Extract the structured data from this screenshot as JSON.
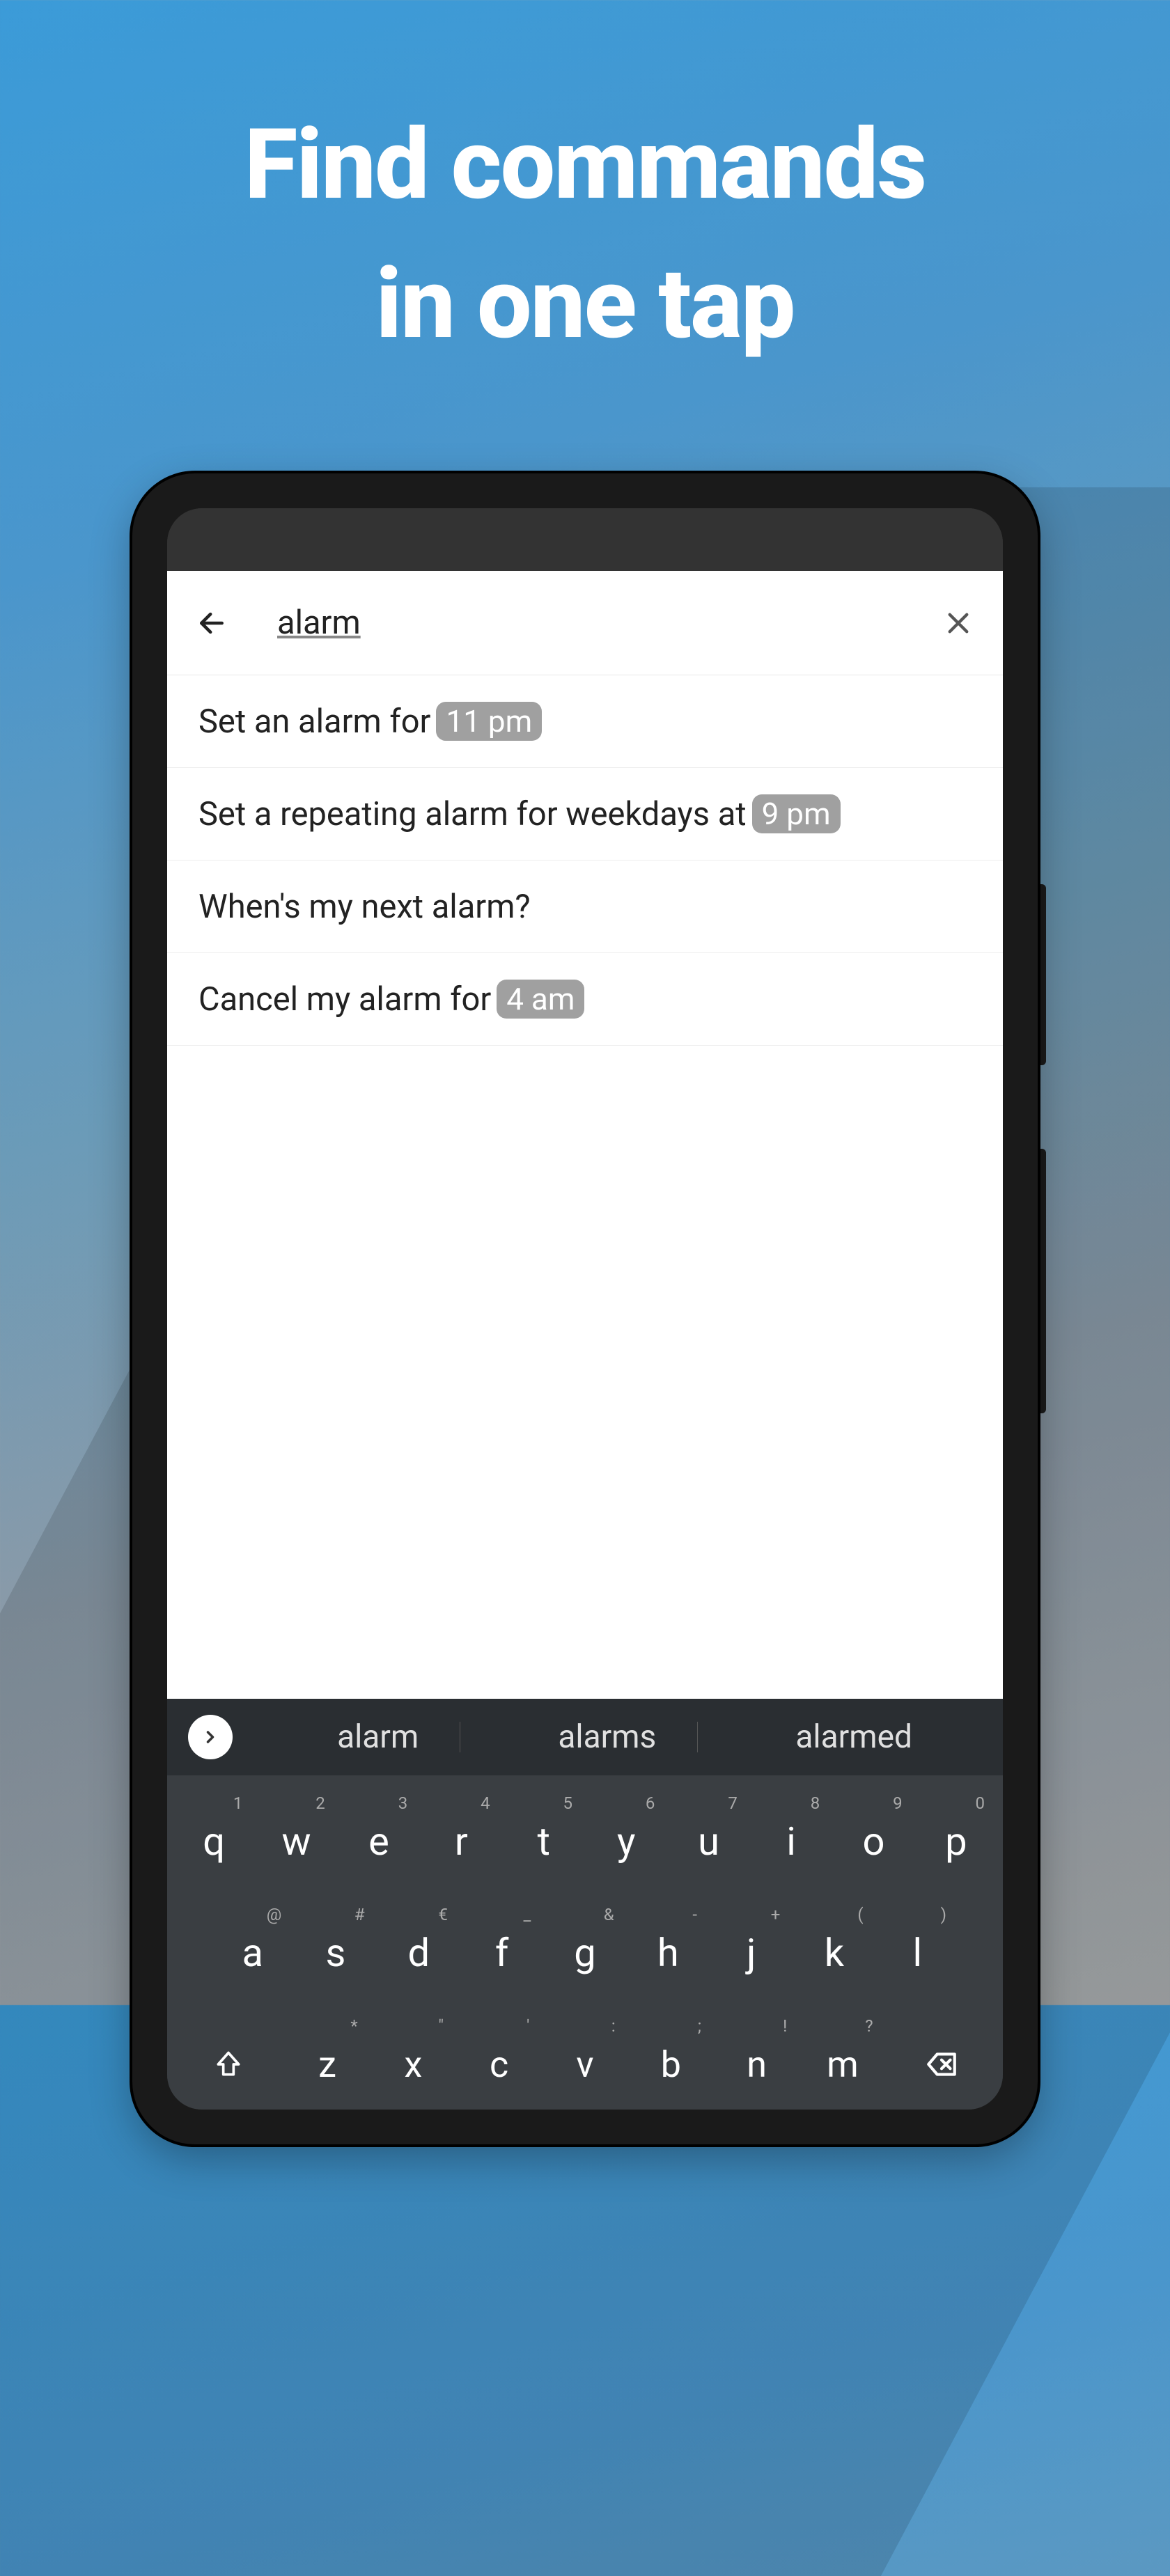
{
  "hero": {
    "line1": "Find commands",
    "line2": "in one tap"
  },
  "search": {
    "query": "alarm"
  },
  "results": [
    {
      "text": "Set an alarm for ",
      "param": "11 pm"
    },
    {
      "text": "Set a repeating alarm for weekdays at ",
      "param": "9 pm"
    },
    {
      "text": "When's my next alarm?",
      "param": null
    },
    {
      "text": "Cancel my alarm for ",
      "param": "4 am"
    }
  ],
  "keyboard": {
    "suggestions": [
      "alarm",
      "alarms",
      "alarmed"
    ],
    "row1": [
      {
        "k": "q",
        "s": "1"
      },
      {
        "k": "w",
        "s": "2"
      },
      {
        "k": "e",
        "s": "3"
      },
      {
        "k": "r",
        "s": "4"
      },
      {
        "k": "t",
        "s": "5"
      },
      {
        "k": "y",
        "s": "6"
      },
      {
        "k": "u",
        "s": "7"
      },
      {
        "k": "i",
        "s": "8"
      },
      {
        "k": "o",
        "s": "9"
      },
      {
        "k": "p",
        "s": "0"
      }
    ],
    "row2": [
      {
        "k": "a",
        "s": "@"
      },
      {
        "k": "s",
        "s": "#"
      },
      {
        "k": "d",
        "s": "€"
      },
      {
        "k": "f",
        "s": "_"
      },
      {
        "k": "g",
        "s": "&"
      },
      {
        "k": "h",
        "s": "-"
      },
      {
        "k": "j",
        "s": "+"
      },
      {
        "k": "k",
        "s": "("
      },
      {
        "k": "l",
        "s": ")"
      }
    ],
    "row3": [
      {
        "k": "z",
        "s": "*"
      },
      {
        "k": "x",
        "s": "\""
      },
      {
        "k": "c",
        "s": "'"
      },
      {
        "k": "v",
        "s": ":"
      },
      {
        "k": "b",
        "s": ";"
      },
      {
        "k": "n",
        "s": "!"
      },
      {
        "k": "m",
        "s": "?"
      }
    ]
  }
}
